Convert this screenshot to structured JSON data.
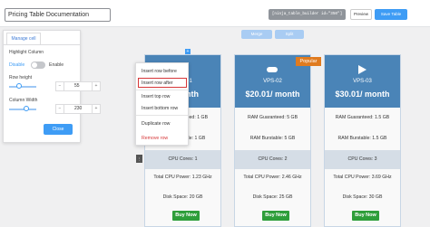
{
  "header": {
    "title": "Pricing Table Documentation",
    "shortcode": "[ninja_table_builder id=\"350\"]",
    "preview_label": "Preview",
    "save_label": "Save Table"
  },
  "toolbar": {
    "merge_label": "Merge",
    "split_label": "Split"
  },
  "cell_panel": {
    "tab_label": "Manage cell",
    "highlight_label": "Highlight Column",
    "disable_label": "Disable",
    "enable_label": "Enable",
    "row_height_label": "Row height",
    "row_height_value": "55",
    "column_width_label": "Column Width",
    "column_width_value": "230",
    "close_label": "Close"
  },
  "context_menu": {
    "items": [
      "Insert row before",
      "Insert row after",
      "Insert top row",
      "Insert bottom row",
      "Duplicate row",
      "Remove row"
    ]
  },
  "columns": [
    {
      "name": "VPS-01",
      "price": "$/month",
      "features": [
        "RAM Guaranteed: 1 GB",
        "RAM Burstable: 1 GB",
        "CPU Cores: 1",
        "Total CPU Power: 1.23 GHz",
        "Disk Space: 20 GB"
      ],
      "button": "Buy Now"
    },
    {
      "name": "VPS-02",
      "price": "$20.01/ month",
      "badge": "Popular",
      "features": [
        "RAM Guaranteed: 5 GB",
        "RAM Burstable: 5 GB",
        "CPU Cores: 2",
        "Total CPU Power: 2.46 GHz",
        "Disk Space: 25 GB"
      ],
      "button": "Buy Now"
    },
    {
      "name": "VPS-03",
      "price": "$30.01/ month",
      "features": [
        "RAM Guaranteed: 1.5 GB",
        "RAM Burstable: 1.5 GB",
        "CPU Cores: 3",
        "Total CPU Power: 3.69 GHz",
        "Disk Space: 30 GB"
      ],
      "button": "Buy Now"
    }
  ],
  "colors": {
    "accent": "#3e9cf5",
    "header_blue": "#4a84b7",
    "buy_green": "#2e9e3a",
    "popular_orange": "#e07b1f",
    "danger": "#d63638"
  }
}
